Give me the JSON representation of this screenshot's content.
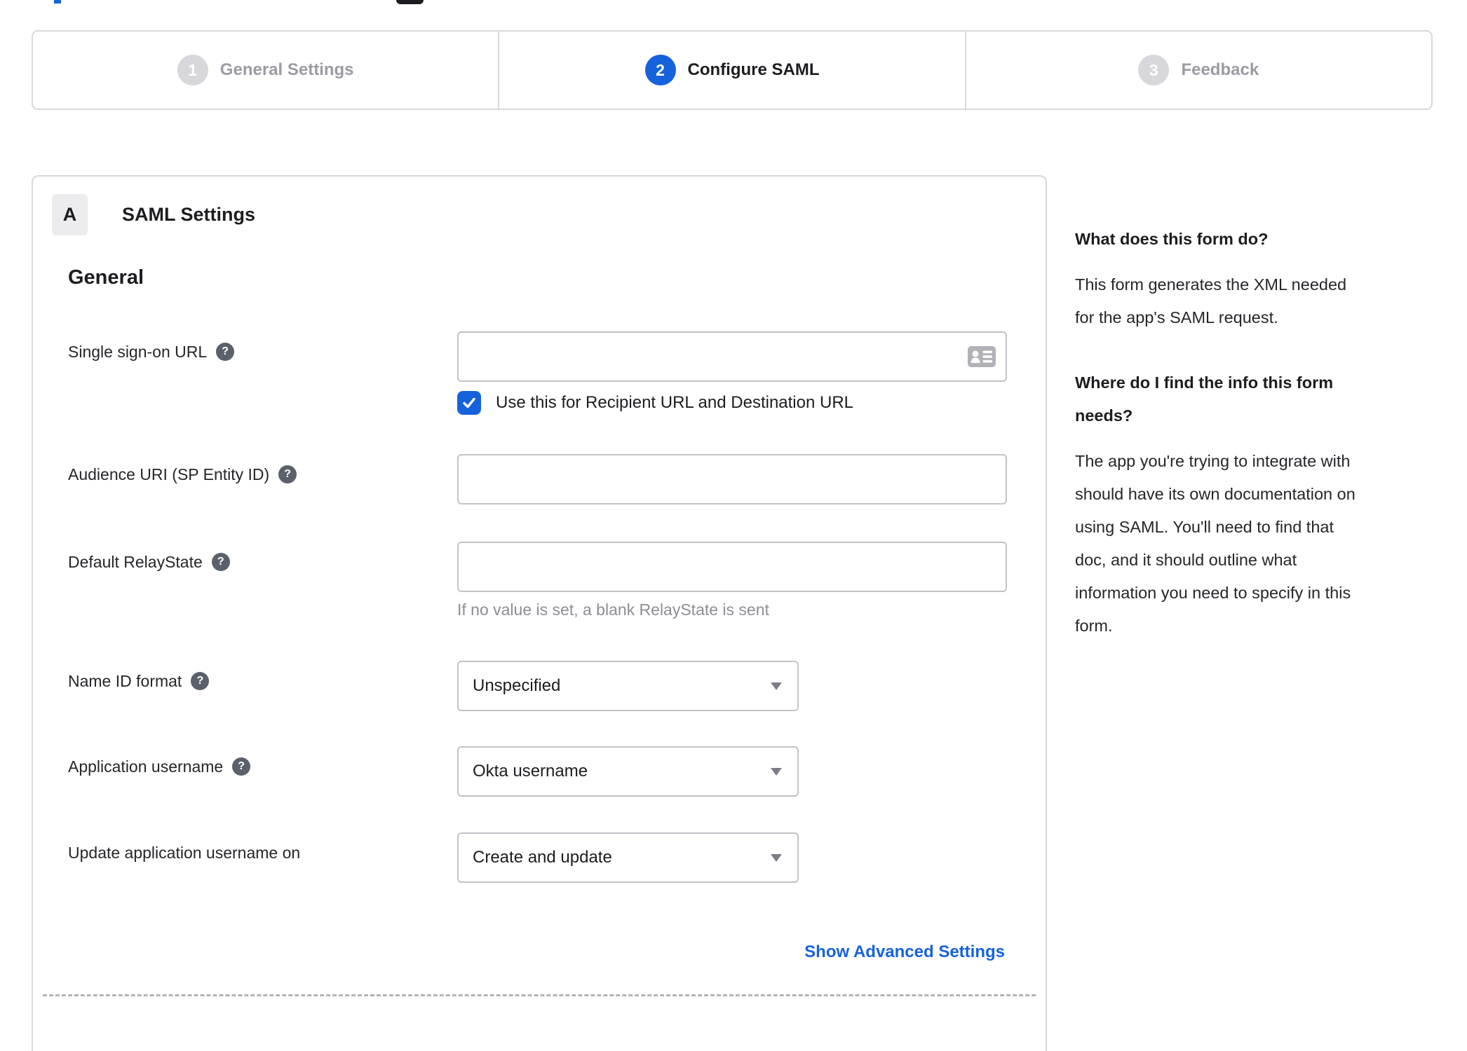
{
  "colors": {
    "accent_blue": "#1662dd",
    "inactive_gray": "#d7d7dc",
    "border_gray": "#c2c2c8",
    "help_icon_gray": "#5a616b",
    "hint_gray": "#8d8d95"
  },
  "stepper": {
    "steps": [
      {
        "number": "1",
        "label": "General Settings",
        "state": "inactive"
      },
      {
        "number": "2",
        "label": "Configure SAML",
        "state": "active"
      },
      {
        "number": "3",
        "label": "Feedback",
        "state": "inactive"
      }
    ]
  },
  "saml_panel": {
    "badge": "A",
    "title": "SAML Settings",
    "section": "General",
    "fields": {
      "sso_url": {
        "label": "Single sign-on URL",
        "value": "",
        "has_help": true
      },
      "sso_checkbox": {
        "label": "Use this for Recipient URL and Destination URL",
        "checked": true
      },
      "audience_uri": {
        "label": "Audience URI (SP Entity ID)",
        "value": "",
        "has_help": true
      },
      "relay_state": {
        "label": "Default RelayState",
        "value": "",
        "hint": "If no value is set, a blank RelayState is sent",
        "has_help": true
      },
      "name_id_format": {
        "label": "Name ID format",
        "value": "Unspecified",
        "has_help": true
      },
      "app_username": {
        "label": "Application username",
        "value": "Okta username",
        "has_help": true
      },
      "update_app_username": {
        "label": "Update application username on",
        "value": "Create and update",
        "has_help": false
      }
    },
    "advanced_link": "Show Advanced Settings",
    "help_glyph": "?"
  },
  "help_sidebar": {
    "q1": "What does this form do?",
    "a1_lines": [
      "This form generates the XML needed",
      "for the app's SAML request."
    ],
    "q2_lines": [
      "Where do I find the info this form",
      "needs?"
    ],
    "a2_lines": [
      "The app you're trying to integrate with",
      "should have its own documentation on",
      "using SAML. You'll need to find that",
      "doc, and it should outline what",
      "information you need to specify in this",
      "form."
    ]
  }
}
